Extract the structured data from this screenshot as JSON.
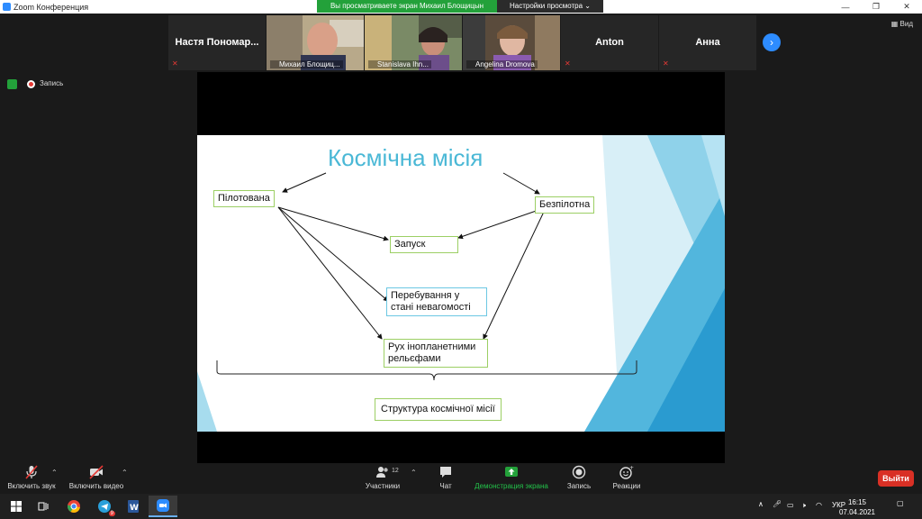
{
  "window": {
    "title": "Zoom Конференция"
  },
  "banner": {
    "message": "Вы просматриваете экран Михаил Блощицын",
    "options_label": "Настройки просмотра ⌄"
  },
  "view_label": "Вид",
  "gallery": [
    {
      "display": "Настя Пономар...",
      "has_video": false
    },
    {
      "display": "Михаил Блощиц...",
      "has_video": true
    },
    {
      "display": "Stanislava Ihn...",
      "has_video": true
    },
    {
      "display": "Angelina Dromova",
      "has_video": true
    },
    {
      "display": "Anton",
      "has_video": false
    },
    {
      "display": "Анна",
      "has_video": false
    }
  ],
  "status": {
    "recording_label": "Запись"
  },
  "slide": {
    "title": "Космічна місія",
    "boxes": {
      "piloted": "Пілотована",
      "unpiloted": "Безпілотна",
      "launch": "Запуск",
      "weightless_1": "Перебування у",
      "weightless_2": "стані невагомості",
      "terrain_1": "Рух інопланетними",
      "terrain_2": "рельєфами",
      "structure": "Структура космічної місії"
    }
  },
  "controls": {
    "audio": "Включить звук",
    "video": "Включить видео",
    "participants": "Участники",
    "participants_count": "12",
    "chat": "Чат",
    "share": "Демонстрация экрана",
    "record": "Запись",
    "reactions": "Реакции",
    "leave": "Выйти"
  },
  "taskbar": {
    "lang": "УКР",
    "time": "16:15",
    "date": "07.04.2021",
    "badge": "9"
  },
  "colors": {
    "accent": "#2d8cff",
    "share_green": "#23a13a",
    "leave_red": "#d93025",
    "slide_title": "#4ab8d6"
  }
}
